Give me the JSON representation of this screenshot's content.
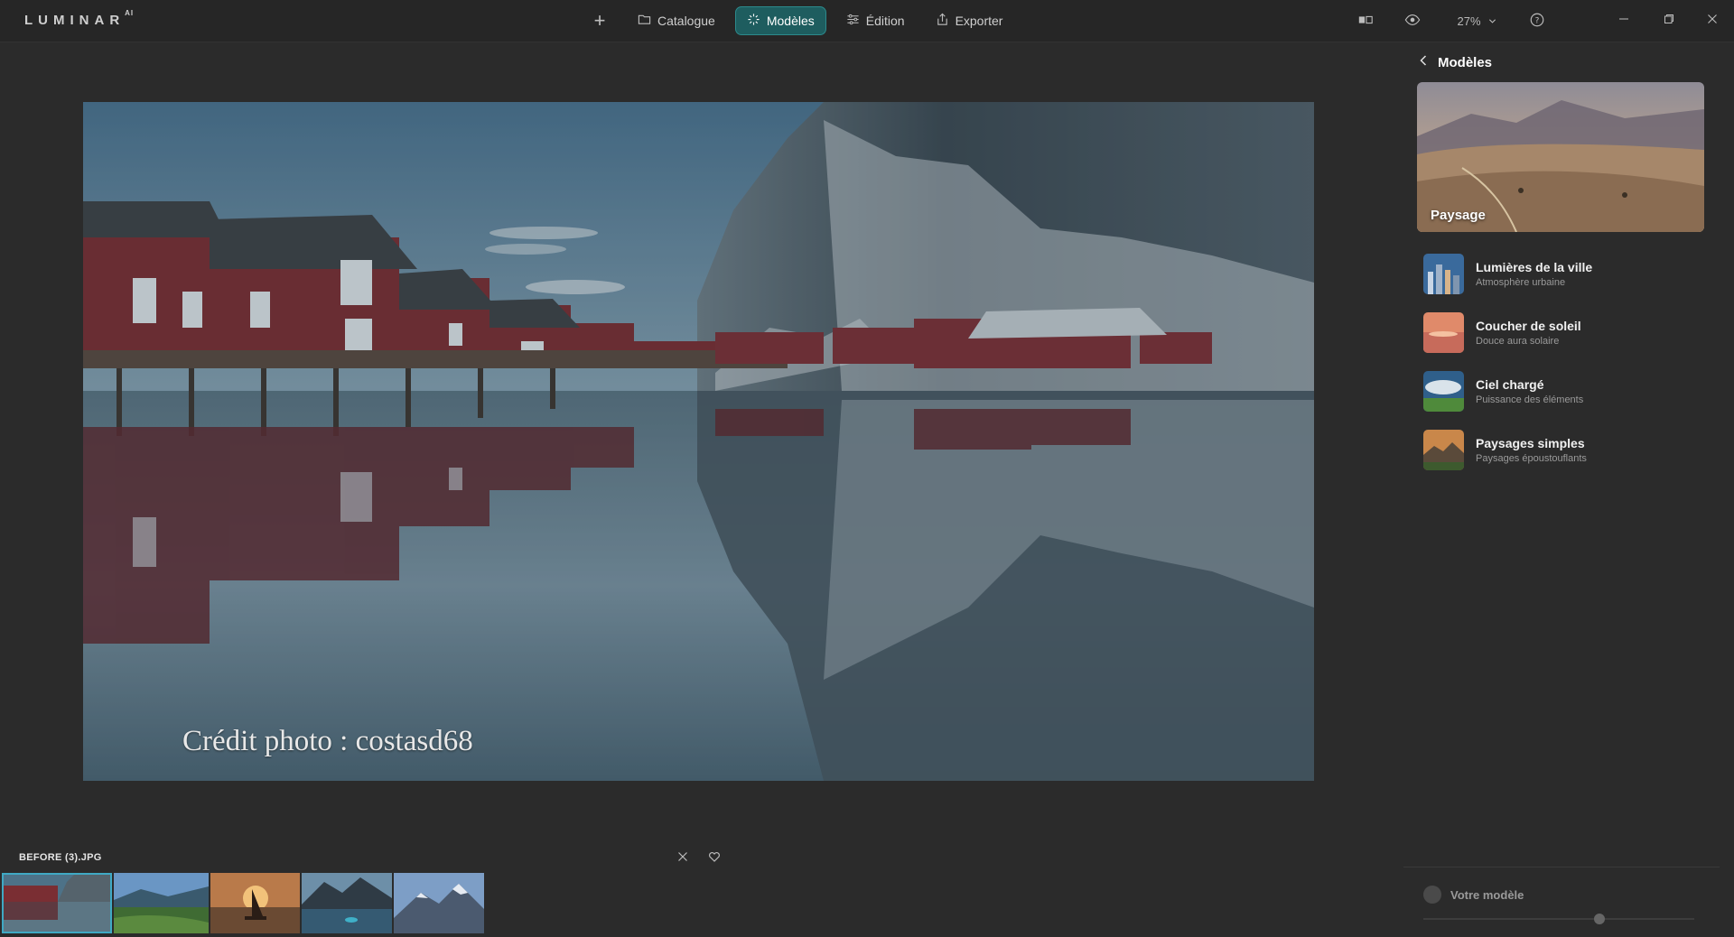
{
  "app": {
    "logo": "LUMINAR",
    "logo_sup": "AI"
  },
  "nav": {
    "add_icon": "plus-icon",
    "items": [
      {
        "label": "Catalogue",
        "icon": "folder-icon",
        "active": false
      },
      {
        "label": "Modèles",
        "icon": "sparkle-icon",
        "active": true
      },
      {
        "label": "Édition",
        "icon": "sliders-icon",
        "active": false
      },
      {
        "label": "Exporter",
        "icon": "share-icon",
        "active": false
      }
    ],
    "accent_color": "#1e5d5f"
  },
  "toolbar": {
    "compare_icon": "compare-icon",
    "preview_icon": "eye-icon",
    "zoom_value": "27%",
    "help_icon": "help-icon"
  },
  "window_controls": [
    "minimize-icon",
    "restore-icon",
    "close-icon"
  ],
  "photo": {
    "watermark": "Crédit photo : costasd68"
  },
  "filmstrip": {
    "filename": "BEFORE (3).JPG",
    "reject_icon": "close-icon",
    "favorite_icon": "heart-icon",
    "selected_color": "#3fa9c4"
  },
  "panel": {
    "back_label": "Modèles",
    "hero_label": "Paysage",
    "templates": [
      {
        "title": "Lumières de la ville",
        "subtitle": "Atmosphère urbaine"
      },
      {
        "title": "Coucher de soleil",
        "subtitle": "Douce aura solaire"
      },
      {
        "title": "Ciel chargé",
        "subtitle": "Puissance des éléments"
      },
      {
        "title": "Paysages simples",
        "subtitle": "Paysages époustouflants"
      }
    ],
    "footer": {
      "your_model_label": "Votre modèle",
      "slider_level": 0.65
    }
  }
}
